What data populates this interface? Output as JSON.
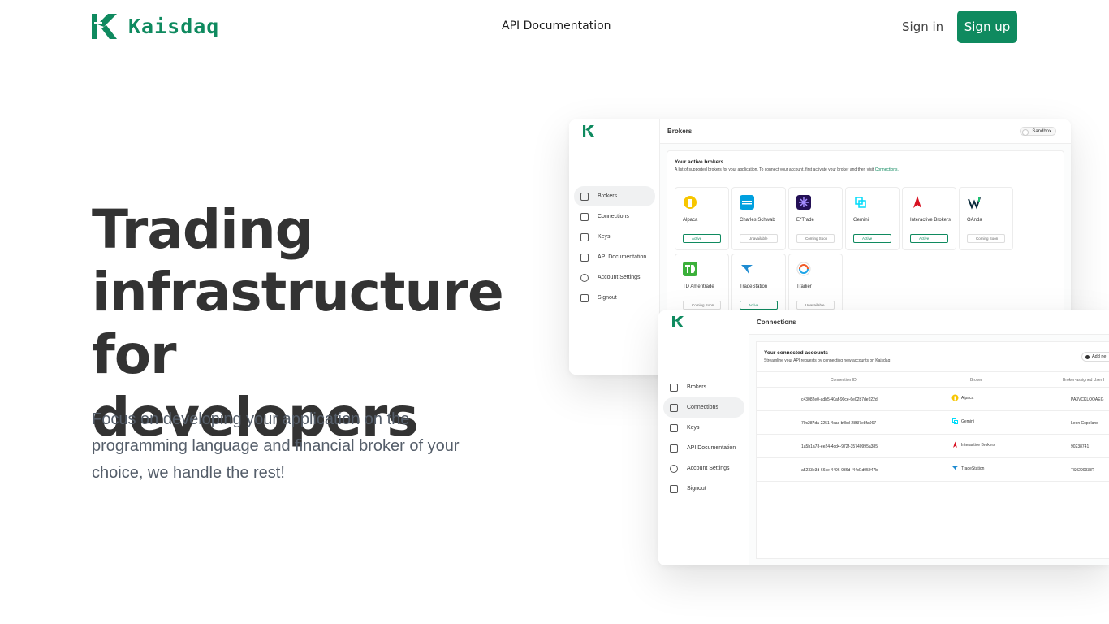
{
  "header": {
    "brand": "Kaisdaq",
    "nav_docs": "API Documentation",
    "sign_in": "Sign in",
    "sign_up": "Sign up"
  },
  "hero": {
    "title_lines": [
      "Trading",
      "infrastructure",
      "for developers"
    ],
    "subtitle": "Focus on developing your application on the programming language and financial broker of your choice, we handle the rest!"
  },
  "colors": {
    "accent": "#0f8a5f",
    "title": "#333333",
    "subtitle": "#555e6a"
  },
  "sidebar": {
    "items": [
      {
        "label": "Brokers",
        "icon": "layers-icon"
      },
      {
        "label": "Connections",
        "icon": "link-icon"
      },
      {
        "label": "Keys",
        "icon": "key-icon"
      },
      {
        "label": "API Documentation",
        "icon": "document-icon"
      },
      {
        "label": "Account Settings",
        "icon": "user-circle-icon"
      },
      {
        "label": "Signout",
        "icon": "logout-icon"
      }
    ]
  },
  "brokers_window": {
    "title": "Brokers",
    "sandbox": "Sandbox",
    "panel_title": "Your active brokers",
    "panel_desc": "A list of supported brokers for your application. To connect your account, first activate your broker and then visit",
    "panel_link": "Connections.",
    "brokers": [
      {
        "name": "Alpaca",
        "status": "Active"
      },
      {
        "name": "Charles Schwab",
        "status": "Unavailable"
      },
      {
        "name": "E*Trade",
        "status": "Coming Soon"
      },
      {
        "name": "Gemini",
        "status": "Active"
      },
      {
        "name": "Interactive Brokers",
        "status": "Active"
      },
      {
        "name": "OAnda",
        "status": "Coming Soon"
      },
      {
        "name": "TD Ameritrade",
        "status": "Coming Soon"
      },
      {
        "name": "TradeStation",
        "status": "Active"
      },
      {
        "name": "Tradier",
        "status": "Unavailable"
      }
    ]
  },
  "connections_window": {
    "title": "Connections",
    "panel_title": "Your connected accounts",
    "panel_desc": "Streamline your API requests by connecting new accounts on Kaisdaq",
    "add_button": "Add ne",
    "columns": [
      "Connection ID",
      "Broker",
      "Broker-assigned User I"
    ],
    "rows": [
      {
        "id": "c43082e0-adb5-40af-90ce-6e02b7de922d",
        "broker": "Alpaca",
        "user": "PA3VCKLOOAEG"
      },
      {
        "id": "70c287da-2251-4cac-b0bd-28f37e8fa067",
        "broker": "Gemini",
        "user": "Leon Copeland"
      },
      {
        "id": "1a5b1a78-ee24-4cd4-972f-35740995a385",
        "broker": "Interactive Brokers",
        "user": "90238741"
      },
      {
        "id": "a5233e3d-66ce-4496-936d-f44d1d05947b",
        "broker": "TradeStation",
        "user": "TS0290938?"
      }
    ]
  }
}
